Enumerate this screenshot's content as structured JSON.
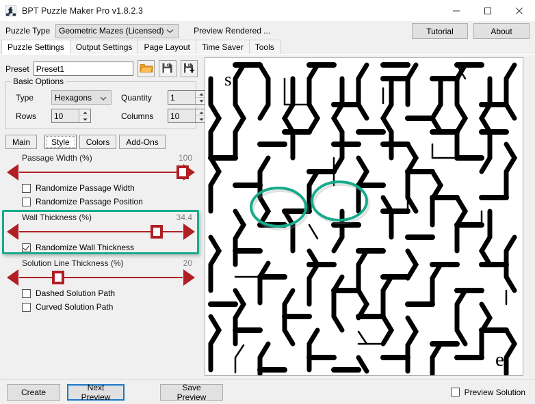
{
  "window": {
    "title": "BPT Puzzle Maker Pro v1.8.2.3",
    "app_icon": "app-logo-icon",
    "minimize_label": "minimize-icon",
    "maximize_label": "maximize-icon",
    "close_label": "close-icon"
  },
  "toolbar": {
    "puzzle_type_label": "Puzzle Type",
    "puzzle_type_value": "Geometric Mazes (Licensed)",
    "status_text": "Preview Rendered ...",
    "tutorial_label": "Tutorial",
    "about_label": "About"
  },
  "tabs": {
    "items": [
      {
        "label": "Puzzle Settings",
        "active": true
      },
      {
        "label": "Output Settings",
        "active": false
      },
      {
        "label": "Page Layout",
        "active": false
      },
      {
        "label": "Time Saver",
        "active": false
      },
      {
        "label": "Tools",
        "active": false
      }
    ]
  },
  "preset": {
    "label": "Preset",
    "value": "Preset1",
    "open_icon": "open-folder-icon",
    "save_icon": "save-floppy-icon",
    "save_as_icon": "save-as-floppy-icon"
  },
  "basic_options": {
    "title": "Basic Options",
    "type_label": "Type",
    "type_value": "Hexagons",
    "quantity_label": "Quantity",
    "quantity_value": "1",
    "rows_label": "Rows",
    "rows_value": "10",
    "columns_label": "Columns",
    "columns_value": "10"
  },
  "subtabs": {
    "items": [
      {
        "label": "Main",
        "active": false
      },
      {
        "label": "Style",
        "active": true
      },
      {
        "label": "Colors",
        "active": false
      },
      {
        "label": "Add-Ons",
        "active": false
      }
    ]
  },
  "style_panel": {
    "passage_width": {
      "title": "Passage Width (%)",
      "value": "100",
      "percent": 100
    },
    "randomize_passage_width": {
      "label": "Randomize Passage Width",
      "checked": false
    },
    "randomize_passage_position": {
      "label": "Randomize Passage Position",
      "checked": false
    },
    "wall_thickness": {
      "title": "Wall Thickness (%)",
      "value": "34.4",
      "percent": 84,
      "highlighted": true
    },
    "randomize_wall_thickness": {
      "label": "Randomize Wall Thickness",
      "checked": true
    },
    "solution_line_thickness": {
      "title": "Solution Line Thickness (%)",
      "value": "20",
      "percent": 24
    },
    "dashed_solution_path": {
      "label": "Dashed Solution Path",
      "checked": false
    },
    "curved_solution_path": {
      "label": "Curved Solution Path",
      "checked": false
    }
  },
  "preview": {
    "start_marker": "s",
    "end_marker": "e",
    "maze_type": "hexagonal",
    "annotation_count": 2
  },
  "bottom": {
    "create_label": "Create",
    "next_preview_label": "Next Preview",
    "save_preview_label": "Save Preview",
    "preview_solution_label": "Preview Solution",
    "preview_solution_checked": false
  },
  "colors": {
    "accent_red": "#b01f24",
    "highlight_teal": "#16ab8b",
    "focus_blue": "#1a78c8",
    "window_bg": "#f0f0f0",
    "folder_orange": "#f0a32a"
  }
}
